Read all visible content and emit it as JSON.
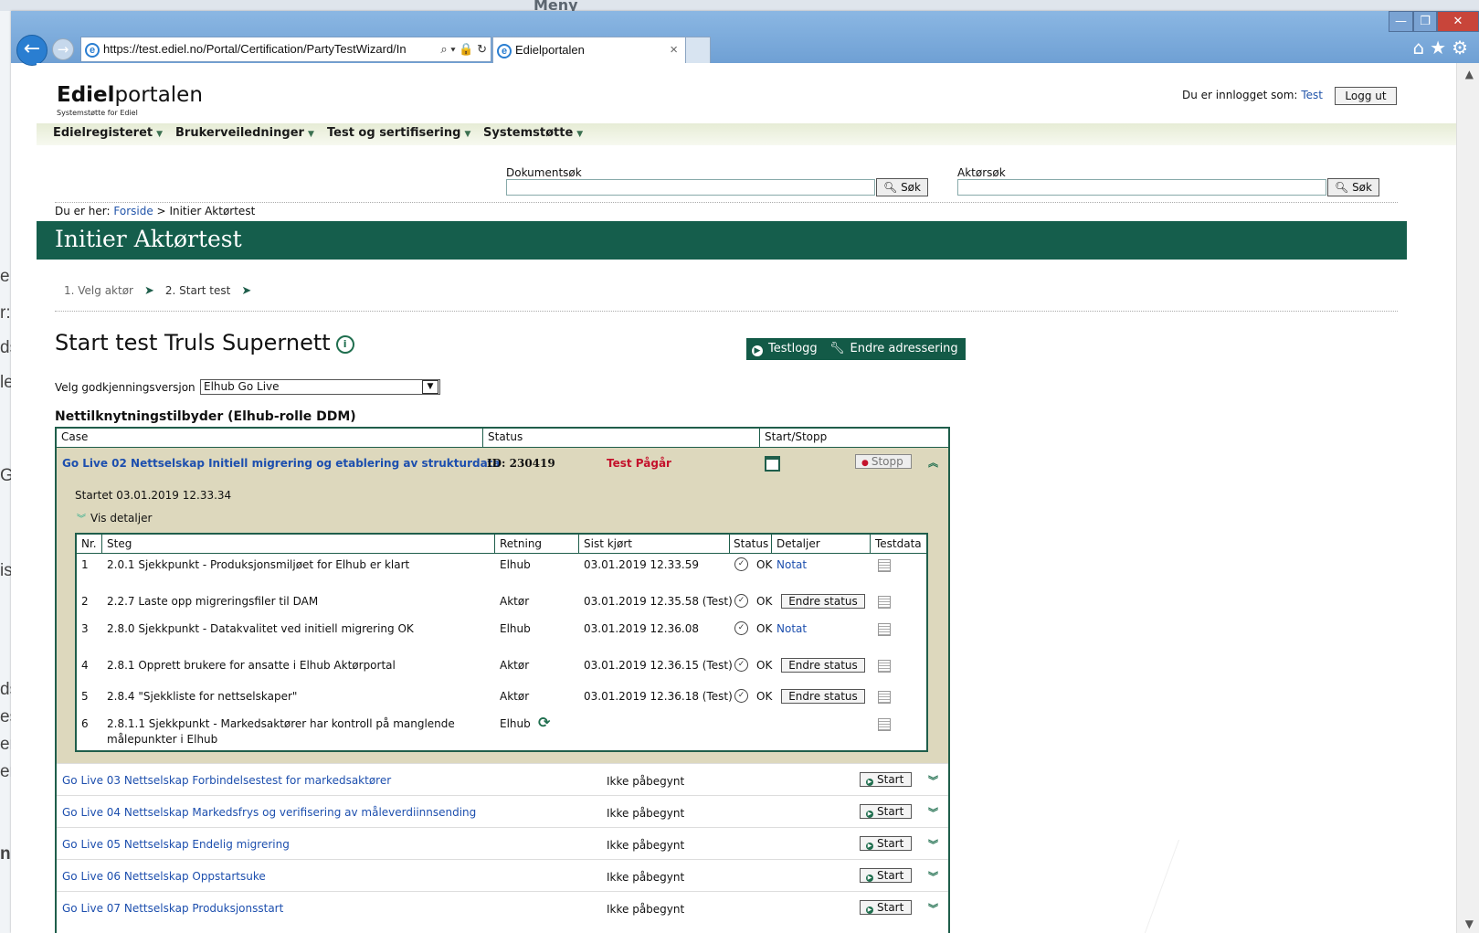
{
  "background": {
    "menu_label": "Meny",
    "left_fragments": [
      "e",
      "r:",
      "ds",
      "le",
      "Gc",
      "is",
      "ds",
      "es",
      "er",
      "er",
      "nc"
    ]
  },
  "browser": {
    "url": "https://test.ediel.no/Portal/Certification/PartyTestWizard/In",
    "tab_title": "Edielportalen",
    "tab_close": "×",
    "win_controls": [
      "—",
      "❐",
      "✕"
    ]
  },
  "header": {
    "logo_bold": "Ediel",
    "logo_rest": "portalen",
    "logo_sub": "Systemstøtte for Ediel",
    "login_prefix": "Du er innlogget som:",
    "login_user": "Test",
    "logout_label": "Logg ut"
  },
  "nav": [
    "Edielregisteret",
    "Brukerveiledninger",
    "Test og sertifisering",
    "Systemstøtte"
  ],
  "search": {
    "doc_label": "Dokumentsøk",
    "actor_label": "Aktørsøk",
    "button_label": "Søk"
  },
  "breadcrumb": {
    "prefix": "Du er her:",
    "home": "Forside",
    "sep": ">",
    "current": "Initier Aktørtest"
  },
  "banner_title": "Initier Aktørtest",
  "wizard": {
    "step1": "1. Velg aktør",
    "step2": "2. Start test"
  },
  "main": {
    "title": "Start test Truls Supernett",
    "testlog_label": "Testlogg",
    "addr_label": "Endre adressering",
    "version_label": "Velg godkjenningsversjon",
    "version_value": "Elhub Go Live",
    "role_heading": "Nettilknytningstilbyder (Elhub-rolle DDM)"
  },
  "case_table": {
    "headers": [
      "Case",
      "Status",
      "Start/Stopp"
    ],
    "expanded": {
      "title": "Go Live 02 Nettselskap Initiell migrering og etablering av strukturdata",
      "id": "ID: 230419",
      "status": "Test Pågår",
      "stop_label": "Stopp",
      "started": "Startet 03.01.2019 12.33.34",
      "details_label": "Vis detaljer",
      "step_headers": [
        "Nr.",
        "Steg",
        "Retning",
        "Sist kjørt",
        "Status",
        "Detaljer",
        "Testdata"
      ],
      "steps": [
        {
          "nr": "1",
          "steg": "2.0.1 Sjekkpunkt - Produksjonsmiljøet for Elhub er klart",
          "retning": "Elhub",
          "sist": "03.01.2019 12.33.59",
          "status": "OK",
          "detalj": "Notat"
        },
        {
          "nr": "2",
          "steg": "2.2.7 Laste opp migreringsfiler til DAM",
          "retning": "Aktør",
          "sist": "03.01.2019 12.35.58 (Test)",
          "status": "OK",
          "detalj": "Endre status"
        },
        {
          "nr": "3",
          "steg": "2.8.0 Sjekkpunkt - Datakvalitet ved initiell migrering OK",
          "retning": "Elhub",
          "sist": "03.01.2019 12.36.08",
          "status": "OK",
          "detalj": "Notat"
        },
        {
          "nr": "4",
          "steg": "2.8.1 Opprett brukere for ansatte i Elhub Aktørportal",
          "retning": "Aktør",
          "sist": "03.01.2019 12.36.15 (Test)",
          "status": "OK",
          "detalj": "Endre status"
        },
        {
          "nr": "5",
          "steg": "2.8.4 \"Sjekkliste for nettselskaper\"",
          "retning": "Aktør",
          "sist": "03.01.2019 12.36.18 (Test)",
          "status": "OK",
          "detalj": "Endre status"
        },
        {
          "nr": "6",
          "steg_line1": "2.8.1.1 Sjekkpunkt - Markedsaktører har kontroll på manglende",
          "steg_line2": "målepunkter i Elhub",
          "retning": "Elhub"
        }
      ]
    },
    "rows": [
      {
        "title": "Go Live 03 Nettselskap Forbindelsestest for markedsaktører",
        "status": "Ikke påbegynt",
        "button": "Start"
      },
      {
        "title": "Go Live 04 Nettselskap Markedsfrys og verifisering av måleverdiinnsending",
        "status": "Ikke påbegynt",
        "button": "Start"
      },
      {
        "title": "Go Live 05 Nettselskap Endelig migrering",
        "status": "Ikke påbegynt",
        "button": "Start"
      },
      {
        "title": "Go Live 06 Nettselskap Oppstartsuke",
        "status": "Ikke påbegynt",
        "button": "Start"
      },
      {
        "title": "Go Live 07 Nettselskap Produksjonsstart",
        "status": "Ikke påbegynt",
        "button": "Start"
      }
    ]
  }
}
